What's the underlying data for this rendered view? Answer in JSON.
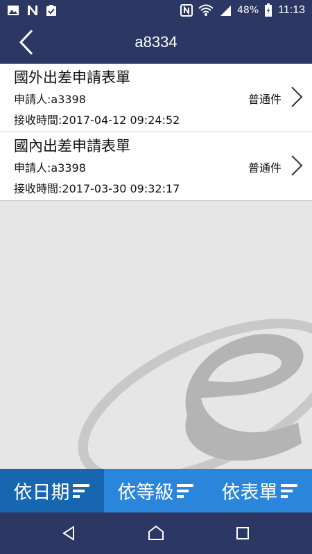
{
  "status_bar": {
    "left_icons": [
      "image-icon",
      "n-logo-icon",
      "clipboard-check-icon"
    ],
    "right_icons": [
      "nfc-icon",
      "wifi-icon",
      "signal-icon",
      "battery-icon"
    ],
    "battery": "48%",
    "time": "11:13"
  },
  "app_bar": {
    "title": "a8334",
    "back_icon": "chevron-left-icon"
  },
  "list": [
    {
      "title": "國外出差申請表單",
      "applicant": "申請人:a3398",
      "received": "接收時間:2017-04-12 09:24:52",
      "level": "普通件"
    },
    {
      "title": "國內出差申請表單",
      "applicant": "申請人:a3398",
      "received": "接收時間:2017-03-30 09:32:17",
      "level": "普通件"
    }
  ],
  "tabs": [
    {
      "label": "依日期",
      "icon": "sort-icon"
    },
    {
      "label": "依等級",
      "icon": "sort-icon"
    },
    {
      "label": "依表單",
      "icon": "sort-icon"
    }
  ],
  "colors": {
    "header": "#2c3764",
    "tab_active": "#1766b0",
    "tab": "#2a86da",
    "background": "#e6e6e6"
  },
  "nav": [
    "back-triangle-icon",
    "home-icon",
    "recents-icon"
  ]
}
